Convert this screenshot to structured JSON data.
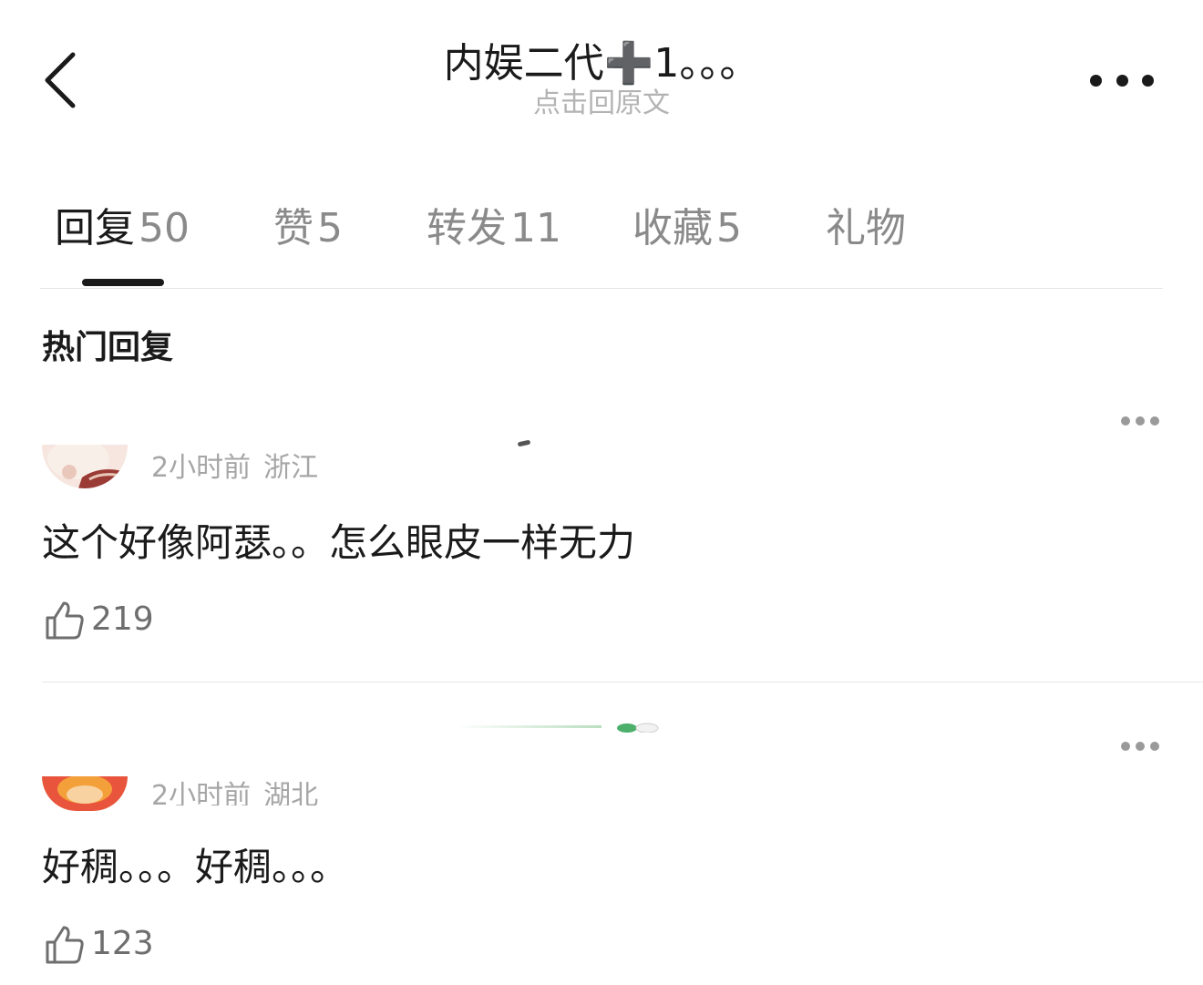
{
  "header": {
    "back_icon": "chevron-left-icon",
    "title": "内娱二代➕1。。。",
    "subtitle": "点击回原文",
    "more_icon": "more-horizontal-icon"
  },
  "tabs": [
    {
      "label": "回复",
      "count": "50",
      "active": true
    },
    {
      "label": "赞",
      "count": "5",
      "active": false
    },
    {
      "label": "转发",
      "count": "11",
      "active": false
    },
    {
      "label": "收藏",
      "count": "5",
      "active": false
    },
    {
      "label": "礼物",
      "count": "",
      "active": false
    }
  ],
  "section": {
    "title": "热门回复"
  },
  "comments": [
    {
      "time": "2小时前",
      "location": "浙江",
      "text": "这个好像阿瑟。。怎么眼皮一样无力",
      "likes": "219",
      "like_icon": "thumbs-up-icon",
      "more_icon": "more-horizontal-icon"
    },
    {
      "time": "2小时前",
      "location": "湖北",
      "text": "好稠。。。好稠。。。",
      "likes": "123",
      "like_icon": "thumbs-up-icon",
      "more_icon": "more-horizontal-icon"
    }
  ],
  "colors": {
    "text_primary": "#1a1a1a",
    "text_secondary": "#8a8a8a",
    "text_meta": "#a6a6a6",
    "divider": "#e6e6e6",
    "background": "#ffffff"
  }
}
